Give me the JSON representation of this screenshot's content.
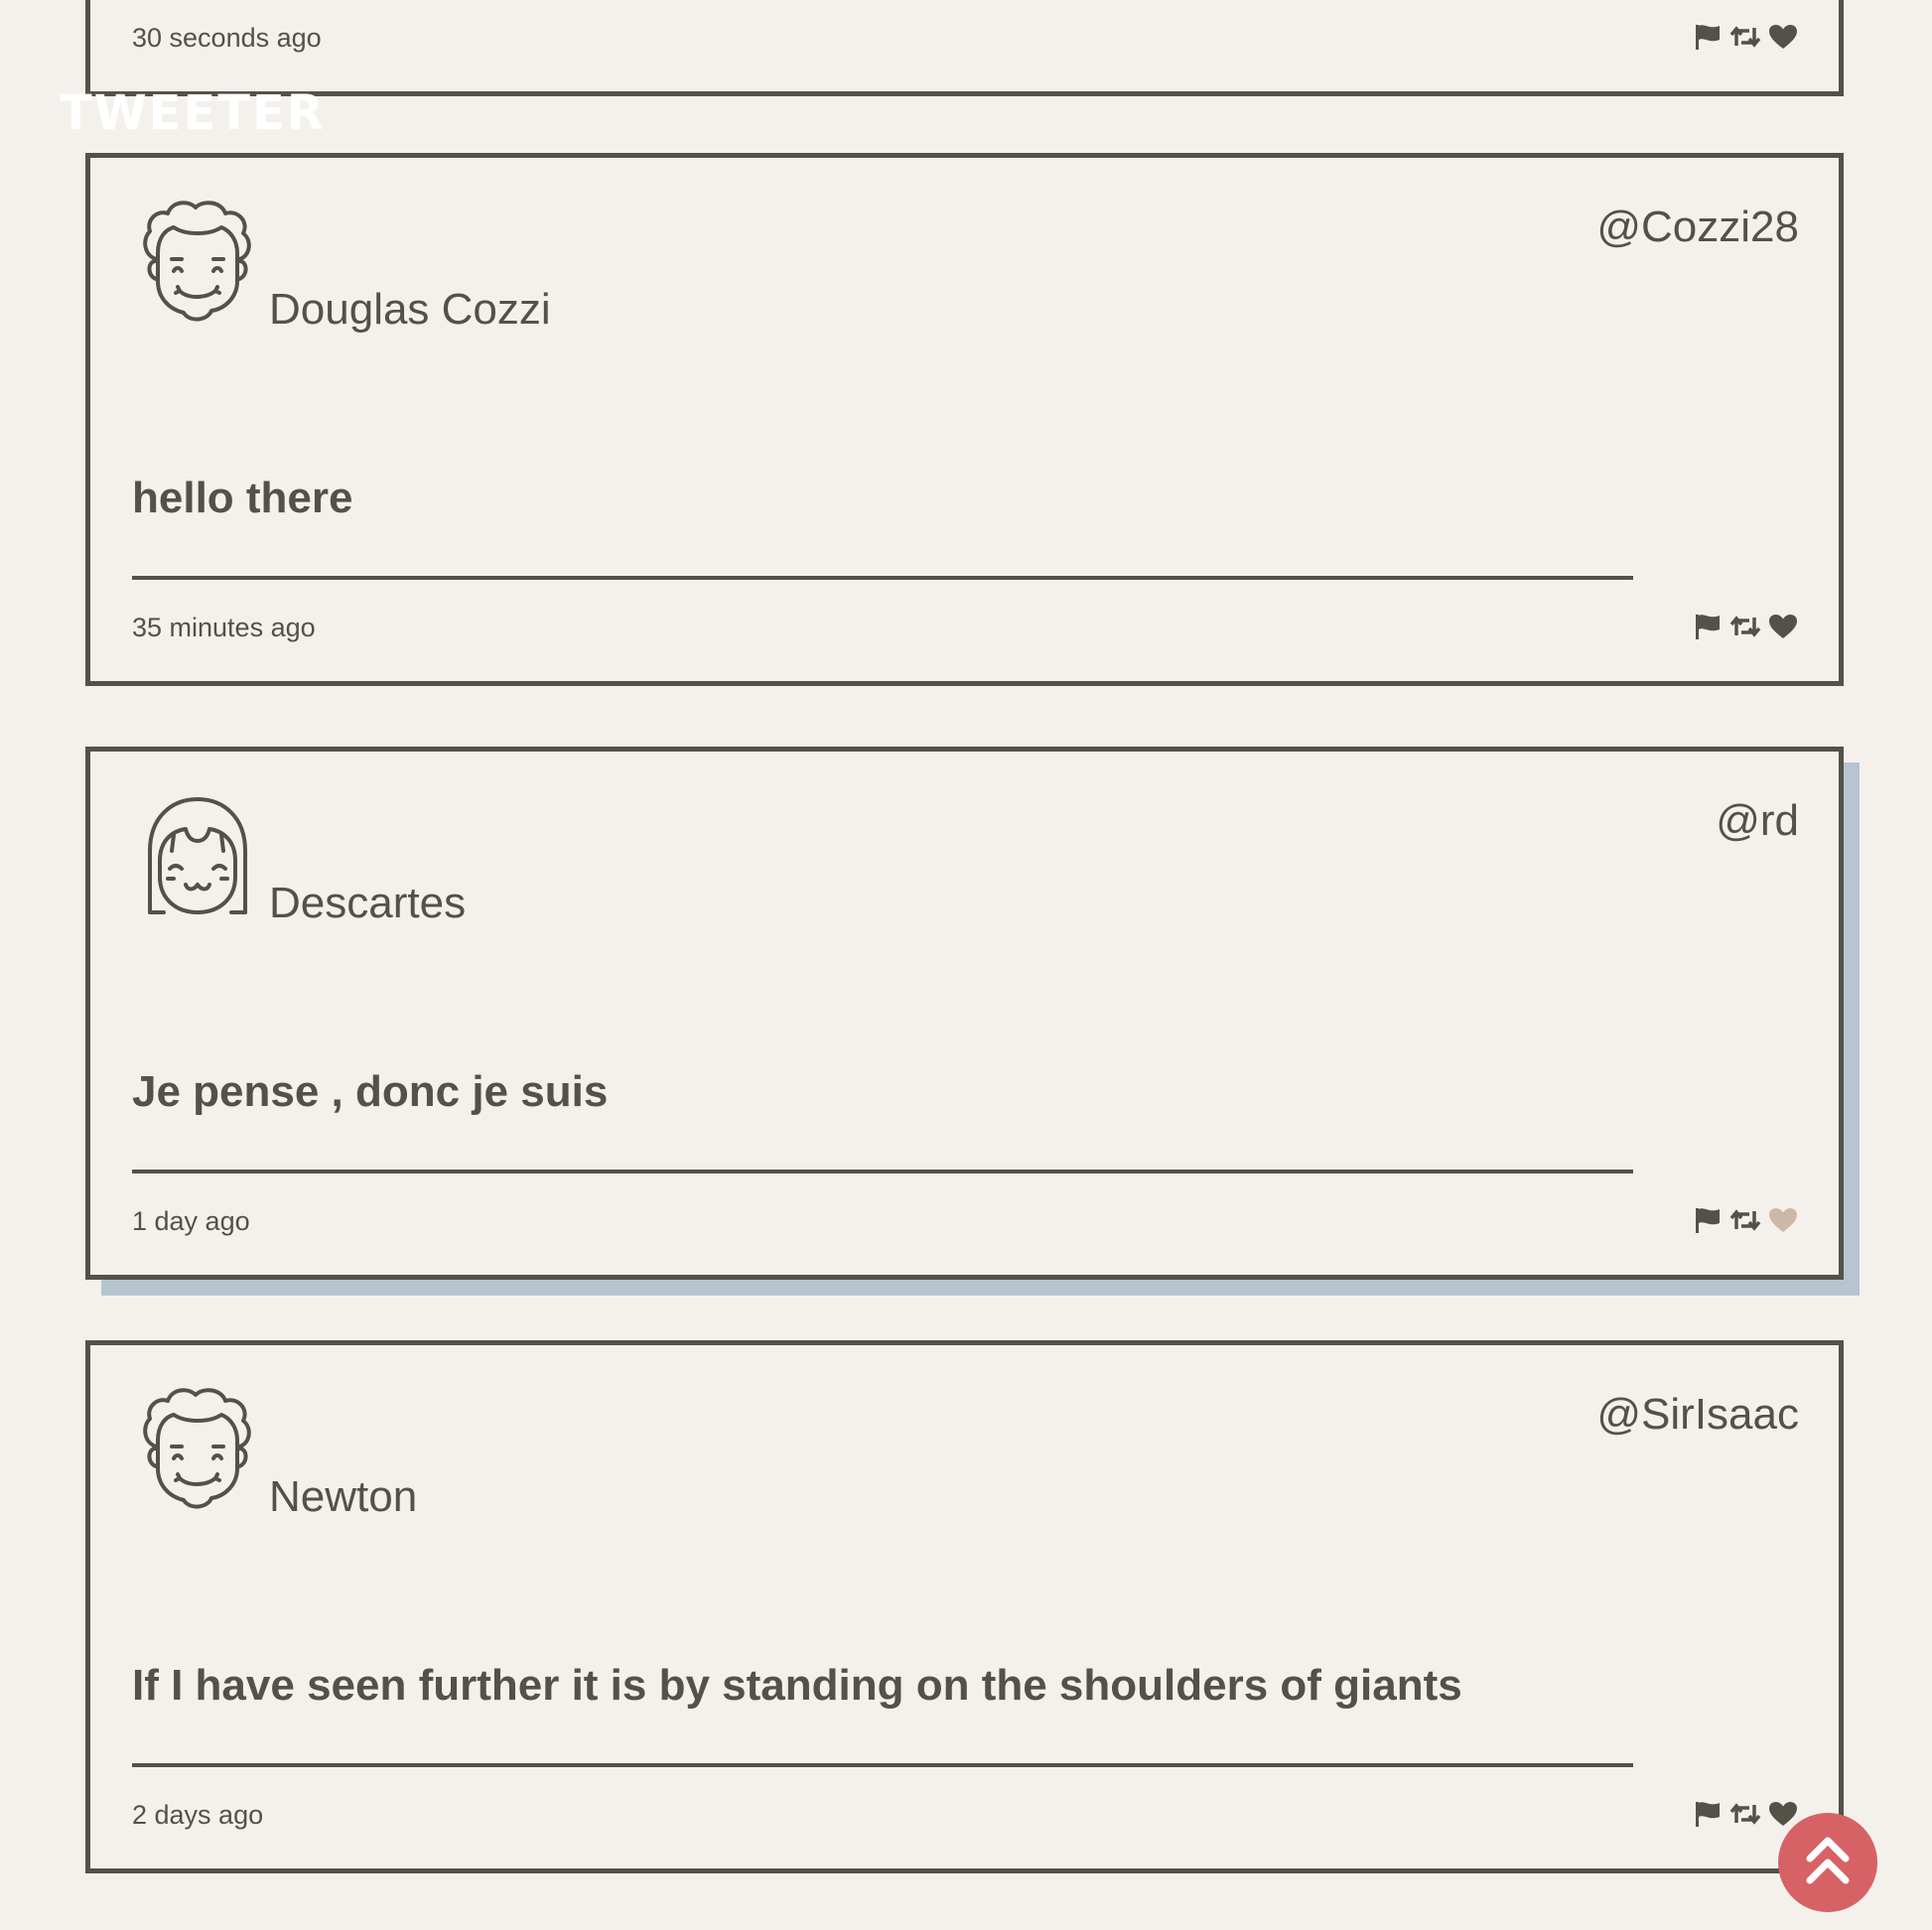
{
  "app": {
    "brand": "TWEETER"
  },
  "colors": {
    "ink": "#545149",
    "background": "#f4f1ec",
    "card_shadow_hover": "#b6c5cf",
    "liked_heart": "#cdb8a8",
    "scroll_top_button": "#d66266"
  },
  "previous_tweet": {
    "timestamp": "30 seconds ago"
  },
  "tweets": [
    {
      "avatar_icon": "curly-hair-face-icon",
      "display_name": "Douglas Cozzi",
      "handle": "@Cozzi28",
      "content": "hello there",
      "timestamp": "35 minutes ago",
      "liked": false
    },
    {
      "avatar_icon": "bob-hair-face-icon",
      "display_name": "Descartes",
      "handle": "@rd",
      "content": "Je pense , donc je suis",
      "timestamp": "1 day ago",
      "liked": true
    },
    {
      "avatar_icon": "curly-hair-face-icon",
      "display_name": "Newton",
      "handle": "@SirIsaac",
      "content": "If I have seen further it is by standing on the shoulders of giants",
      "timestamp": "2 days ago",
      "liked": false
    }
  ],
  "icons": {
    "flag": "flag-icon",
    "retweet": "retweet-icon",
    "like": "heart-icon",
    "scroll_top": "double-chevron-up-icon"
  }
}
